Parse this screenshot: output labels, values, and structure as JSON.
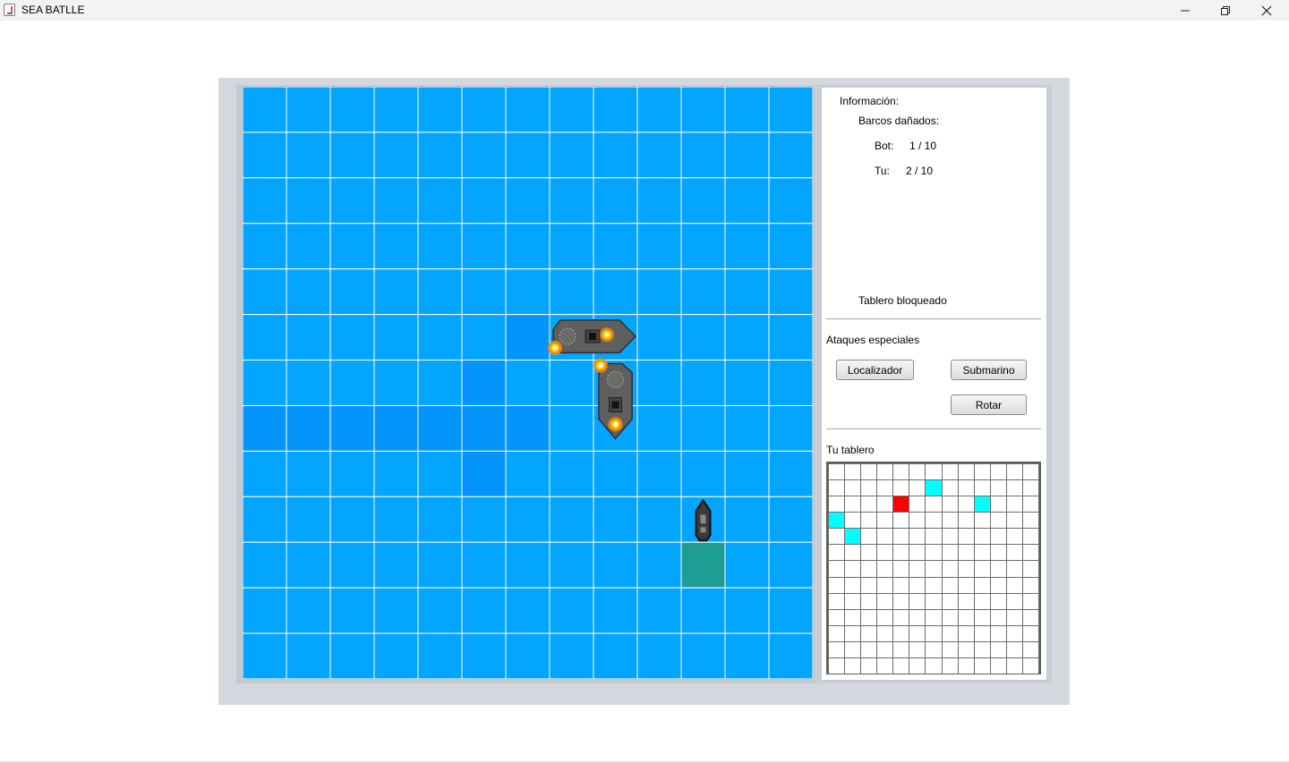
{
  "window": {
    "title": "SEA BATLLE"
  },
  "colors": {
    "water": "#03a5fe",
    "water_shaded": "#0395fb",
    "miss": "#1e9d95",
    "grid_line": "#ffffff",
    "mini_empty": "#ffffff",
    "mini_ship": "#00ffff",
    "mini_hit": "#ff0000"
  },
  "icons": {
    "window_icon": "java-cup-icon",
    "ship": "battleship-icon",
    "fire": "fire-icon"
  },
  "info": {
    "heading": "Información:",
    "damaged_label": "Barcos dañados:",
    "bot_label": "Bot:",
    "bot_value": "1 / 10",
    "you_label": "Tu:",
    "you_value": "2 / 10",
    "status": "Tablero bloqueado"
  },
  "special_attacks": {
    "heading": "Ataques especiales",
    "locator_label": "Localizador",
    "submarine_label": "Submarino",
    "rotate_label": "Rotar"
  },
  "your_board": {
    "heading": "Tu tablero",
    "rows": 13,
    "cols": 13,
    "ship_cells": [
      [
        1,
        6
      ],
      [
        2,
        9
      ],
      [
        3,
        0
      ],
      [
        4,
        1
      ]
    ],
    "hit_cells": [
      [
        2,
        4
      ]
    ]
  },
  "enemy_board": {
    "rows": 13,
    "cols": 13,
    "shaded_cells": [
      [
        5,
        6
      ],
      [
        6,
        5
      ],
      [
        7,
        0
      ],
      [
        7,
        1
      ],
      [
        7,
        2
      ],
      [
        7,
        3
      ],
      [
        7,
        4
      ],
      [
        7,
        5
      ],
      [
        7,
        6
      ],
      [
        8,
        5
      ]
    ],
    "miss_cells": [
      [
        10,
        10
      ]
    ],
    "ships": [
      {
        "name": "damaged-ship-horizontal",
        "row": 5,
        "col": 7,
        "length": 2,
        "orientation": "horizontal",
        "fires": 2
      },
      {
        "name": "damaged-ship-vertical",
        "row": 6,
        "col": 8,
        "length": 2,
        "orientation": "vertical",
        "fires": 2
      },
      {
        "name": "small-ship",
        "row": 9,
        "col": 10,
        "length": 1,
        "orientation": "vertical",
        "fires": 0
      }
    ]
  }
}
